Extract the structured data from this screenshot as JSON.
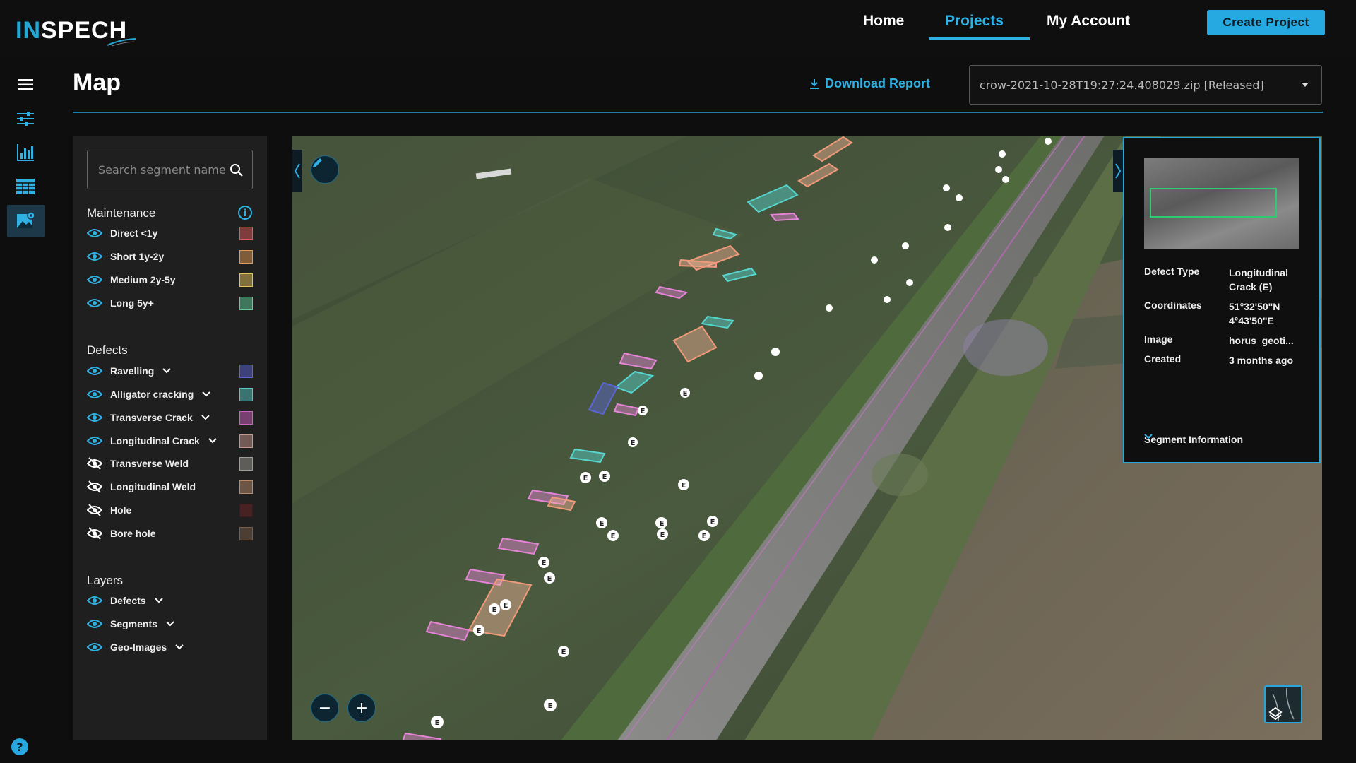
{
  "app": {
    "logo_prefix": "IN",
    "logo_suffix": "SPECH"
  },
  "nav": {
    "home": "Home",
    "projects": "Projects",
    "account": "My Account",
    "create": "Create Project"
  },
  "page": {
    "title": "Map",
    "download": "Download Report",
    "file": "crow-2021-10-28T19:27:24.408029.zip [Released]"
  },
  "search": {
    "placeholder": "Search segment name"
  },
  "maintenance": {
    "title": "Maintenance",
    "items": [
      {
        "label": "Direct <1y",
        "color": "#e05a5a"
      },
      {
        "label": "Short 1y-2y",
        "color": "#e29a52"
      },
      {
        "label": "Medium 2y-5y",
        "color": "#e6c15a"
      },
      {
        "label": "Long 5y+",
        "color": "#5fcf9a"
      }
    ]
  },
  "defects": {
    "title": "Defects",
    "items": [
      {
        "label": "Ravelling",
        "color": "#5b66d6"
      },
      {
        "label": "Alligator cracking",
        "color": "#56c9c4"
      },
      {
        "label": "Transverse Crack",
        "color": "#d062c1"
      },
      {
        "label": "Longitudinal Crack",
        "color": "#c9958a"
      },
      {
        "label": "Transverse Weld",
        "color": "#a09b94"
      },
      {
        "label": "Longitudinal Weld",
        "color": "#b98b6a"
      },
      {
        "label": "Hole",
        "color": "#5a2424"
      },
      {
        "label": "Bore hole",
        "color": "#7a5d47"
      }
    ]
  },
  "layers": {
    "title": "Layers",
    "items": [
      {
        "label": "Defects"
      },
      {
        "label": "Segments"
      },
      {
        "label": "Geo-Images"
      }
    ]
  },
  "card": {
    "defect_type_key": "Defect Type",
    "defect_type_val": "Longitudinal Crack (E)",
    "coords_key": "Coordinates",
    "coords_val_1": "51°32'50\"N",
    "coords_val_2": "4°43'50\"E",
    "image_key": "Image",
    "image_val": "horus_geoti...",
    "created_key": "Created",
    "created_val": "3 months ago",
    "segment_info": "Segment Information"
  },
  "map": {
    "zoom_out": "−",
    "zoom_in": "+",
    "marker_label": "E"
  },
  "help": "?"
}
